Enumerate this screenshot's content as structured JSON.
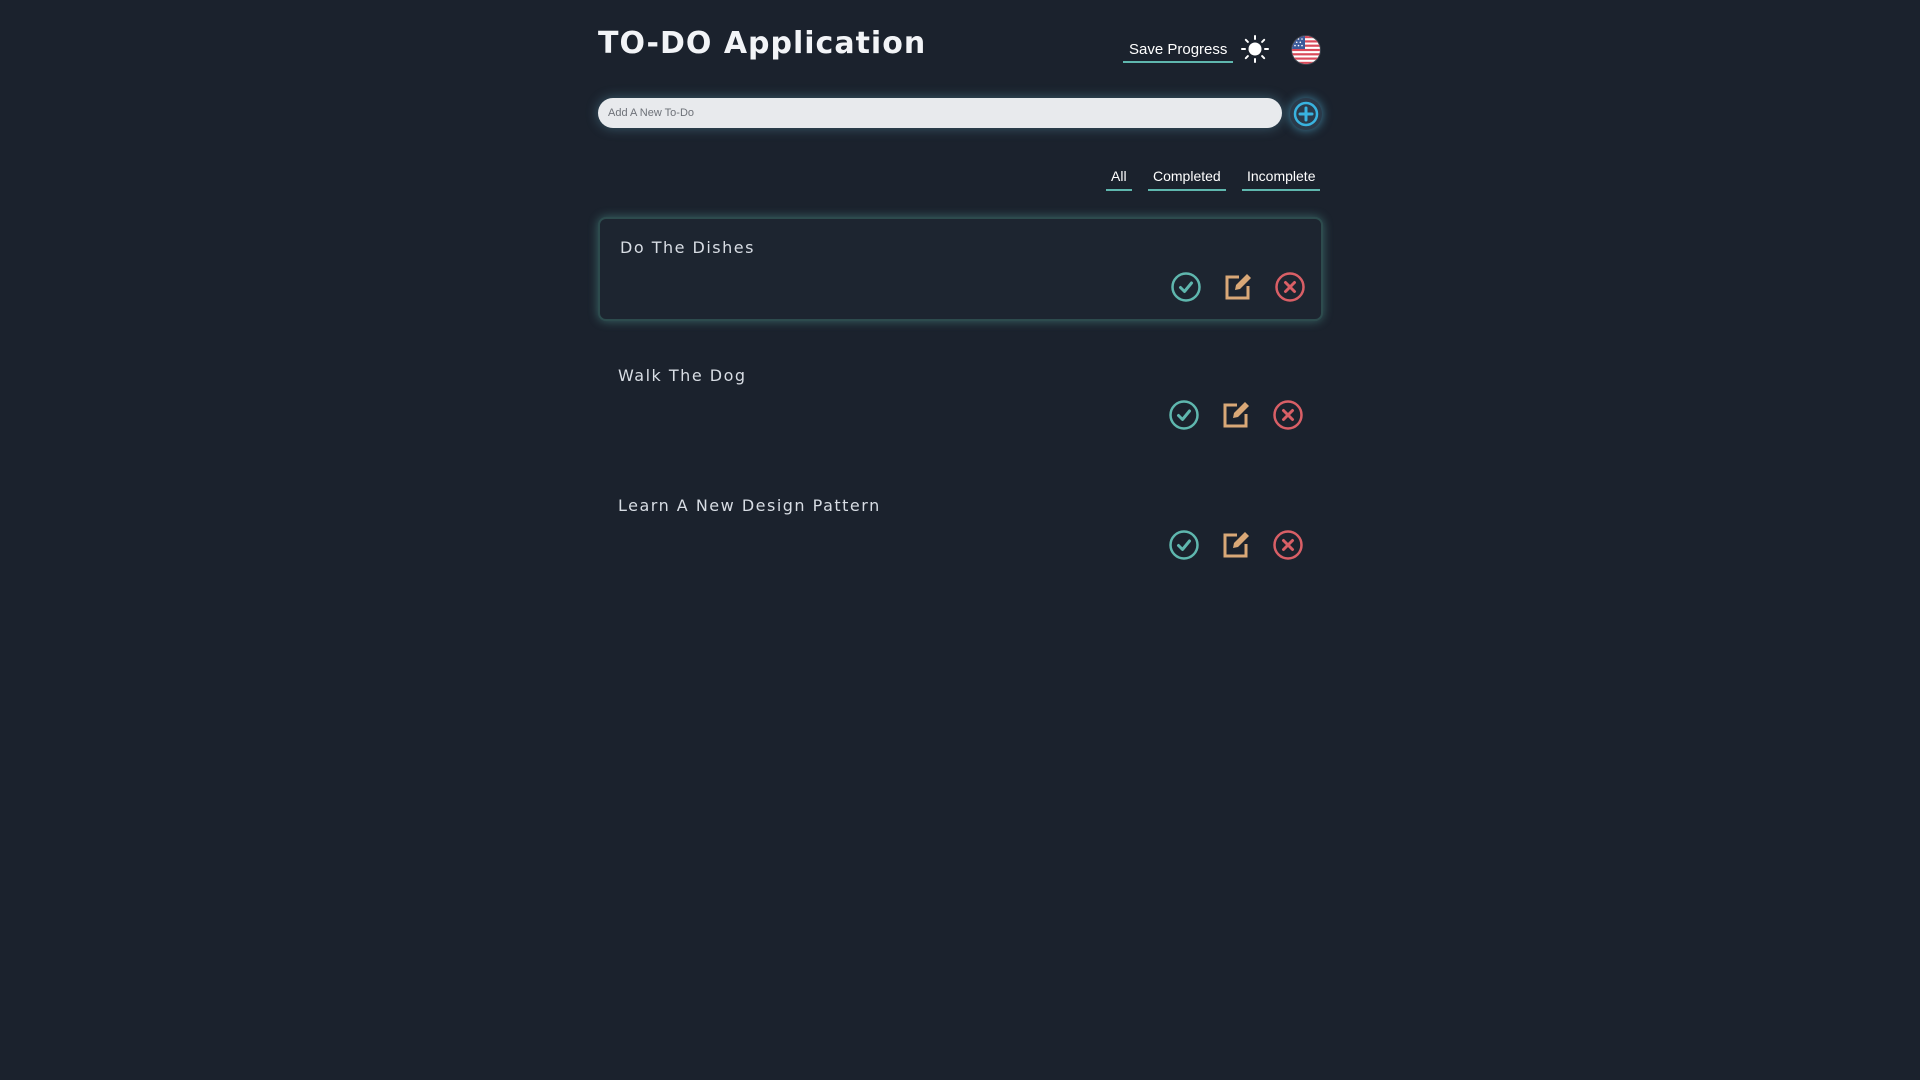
{
  "app": {
    "title": "TO-DO Application",
    "save_label": "Save Progress",
    "theme_icon": "sun-icon",
    "language_icon": "us-flag-icon"
  },
  "add": {
    "placeholder": "Add A New To-Do",
    "button_icon": "plus-icon"
  },
  "filters": {
    "all": "All",
    "completed": "Completed",
    "incomplete": "Incomplete"
  },
  "todos": [
    {
      "text": "Do The Dishes"
    },
    {
      "text": "Walk The Dog"
    },
    {
      "text": "Learn A New Design Pattern"
    }
  ],
  "colors": {
    "background": "#1b222d",
    "accent": "#5fb7ae",
    "complete": "#5fb7ae",
    "edit": "#d9a877",
    "delete": "#d95f66",
    "add_button": "#39b3e0"
  }
}
